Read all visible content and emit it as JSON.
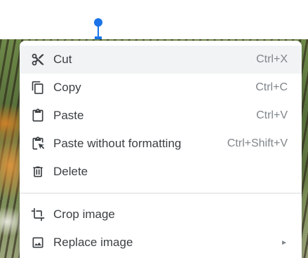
{
  "menu": {
    "items": [
      {
        "label": "Cut",
        "shortcut": "Ctrl+X",
        "icon": "scissors-icon"
      },
      {
        "label": "Copy",
        "shortcut": "Ctrl+C",
        "icon": "copy-icon"
      },
      {
        "label": "Paste",
        "shortcut": "Ctrl+V",
        "icon": "clipboard-icon"
      },
      {
        "label": "Paste without formatting",
        "shortcut": "Ctrl+Shift+V",
        "icon": "paste-plain-icon"
      },
      {
        "label": "Delete",
        "shortcut": "",
        "icon": "trash-icon"
      }
    ],
    "items2": [
      {
        "label": "Crop image",
        "icon": "crop-icon"
      },
      {
        "label": "Replace image",
        "icon": "image-icon",
        "submenu_arrow": "►"
      }
    ]
  },
  "colors": {
    "accent": "#1a73e8",
    "text": "#3c4043",
    "muted": "#80868b",
    "hover": "#f1f3f4"
  }
}
